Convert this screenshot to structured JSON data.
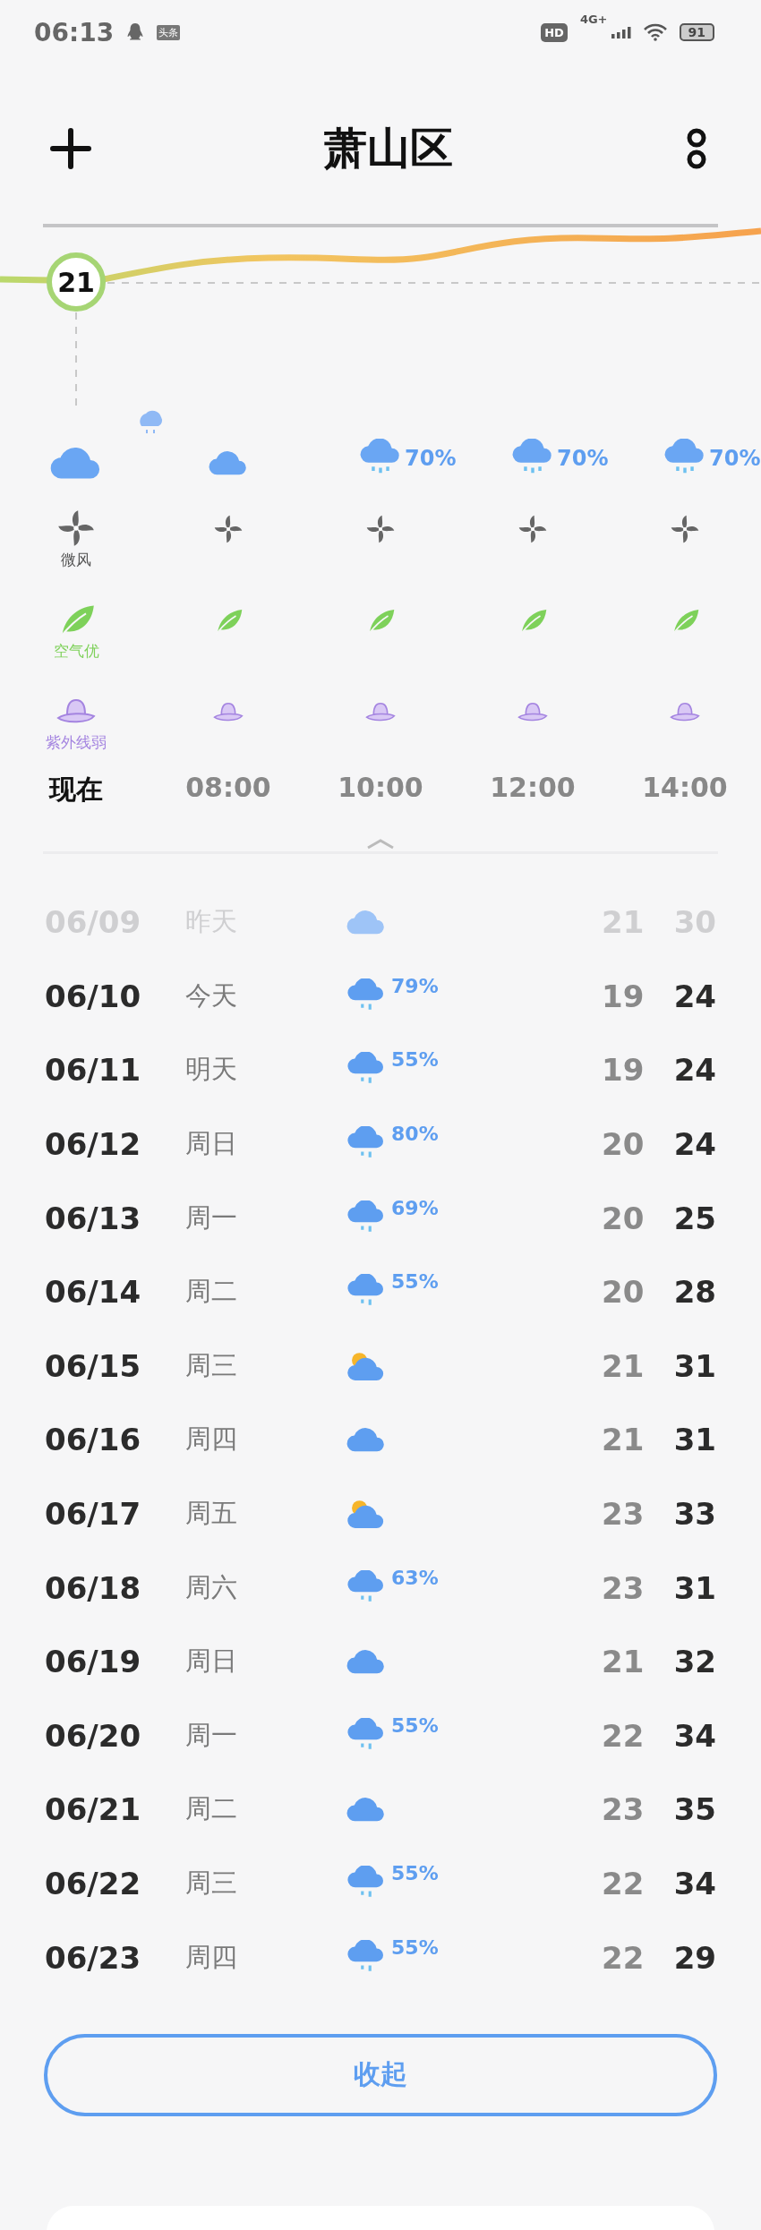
{
  "status_bar": {
    "time": "06:13",
    "news_badge": "头条",
    "hd": "HD",
    "network": "4G+",
    "battery": "91"
  },
  "header": {
    "title": "萧山区"
  },
  "current": {
    "temperature": "21"
  },
  "hourly": [
    {
      "time": "现在",
      "selected": true,
      "kind": "cloud",
      "wind": "微风",
      "air": "空气优",
      "uv": "紫外线弱"
    },
    {
      "time": "08:00",
      "selected": false,
      "kind": "cloud"
    },
    {
      "time": "10:00",
      "selected": false,
      "kind": "rain",
      "precip": "70%"
    },
    {
      "time": "12:00",
      "selected": false,
      "kind": "rain",
      "precip": "70%"
    },
    {
      "time": "14:00",
      "selected": false,
      "kind": "rain",
      "precip": "70%"
    }
  ],
  "daily": [
    {
      "date": "06/09",
      "day": "昨天",
      "kind": "cloud",
      "low": "21",
      "high": "30",
      "past": true
    },
    {
      "date": "06/10",
      "day": "今天",
      "kind": "rain",
      "precip": "79%",
      "low": "19",
      "high": "24",
      "past": false
    },
    {
      "date": "06/11",
      "day": "明天",
      "kind": "rain",
      "precip": "55%",
      "low": "19",
      "high": "24",
      "past": false
    },
    {
      "date": "06/12",
      "day": "周日",
      "kind": "rain",
      "precip": "80%",
      "low": "20",
      "high": "24",
      "past": false
    },
    {
      "date": "06/13",
      "day": "周一",
      "kind": "rain",
      "precip": "69%",
      "low": "20",
      "high": "25",
      "past": false
    },
    {
      "date": "06/14",
      "day": "周二",
      "kind": "rain",
      "precip": "55%",
      "low": "20",
      "high": "28",
      "past": false
    },
    {
      "date": "06/15",
      "day": "周三",
      "kind": "sun-cloud",
      "low": "21",
      "high": "31",
      "past": false
    },
    {
      "date": "06/16",
      "day": "周四",
      "kind": "cloud",
      "low": "21",
      "high": "31",
      "past": false
    },
    {
      "date": "06/17",
      "day": "周五",
      "kind": "sun-cloud",
      "low": "23",
      "high": "33",
      "past": false
    },
    {
      "date": "06/18",
      "day": "周六",
      "kind": "rain",
      "precip": "63%",
      "low": "23",
      "high": "31",
      "past": false
    },
    {
      "date": "06/19",
      "day": "周日",
      "kind": "cloud",
      "low": "21",
      "high": "32",
      "past": false
    },
    {
      "date": "06/20",
      "day": "周一",
      "kind": "rain",
      "precip": "55%",
      "low": "22",
      "high": "34",
      "past": false
    },
    {
      "date": "06/21",
      "day": "周二",
      "kind": "cloud",
      "low": "23",
      "high": "35",
      "past": false
    },
    {
      "date": "06/22",
      "day": "周三",
      "kind": "rain",
      "precip": "55%",
      "low": "22",
      "high": "34",
      "past": false
    },
    {
      "date": "06/23",
      "day": "周四",
      "kind": "rain",
      "precip": "55%",
      "low": "22",
      "high": "29",
      "past": false
    }
  ],
  "collapse_button": "收起"
}
